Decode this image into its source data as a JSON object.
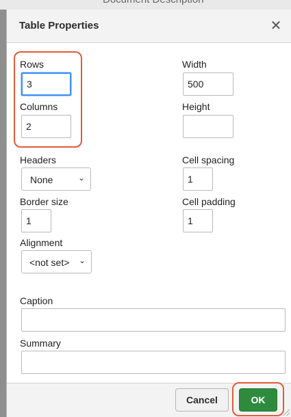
{
  "background": {
    "text": "Document Description"
  },
  "dialog": {
    "title": "Table Properties",
    "close_symbol": "✕",
    "rows": {
      "label": "Rows",
      "value": "3"
    },
    "columns": {
      "label": "Columns",
      "value": "2"
    },
    "width": {
      "label": "Width",
      "value": "500"
    },
    "height": {
      "label": "Height",
      "value": ""
    },
    "headers": {
      "label": "Headers",
      "selected": "None"
    },
    "cell_spacing": {
      "label": "Cell spacing",
      "value": "1"
    },
    "border_size": {
      "label": "Border size",
      "value": "1"
    },
    "cell_padding": {
      "label": "Cell padding",
      "value": "1"
    },
    "alignment": {
      "label": "Alignment",
      "selected": "<not set>"
    },
    "caption": {
      "label": "Caption",
      "value": ""
    },
    "summary": {
      "label": "Summary",
      "value": ""
    },
    "buttons": {
      "cancel": "Cancel",
      "ok": "OK"
    }
  },
  "colors": {
    "highlight": "#e25a3a",
    "ok_button": "#2e8b3e",
    "focus_ring": "#3b8ff5"
  },
  "icons": [
    "close-icon",
    "chevron-down-icon",
    "resize-handle-icon"
  ]
}
